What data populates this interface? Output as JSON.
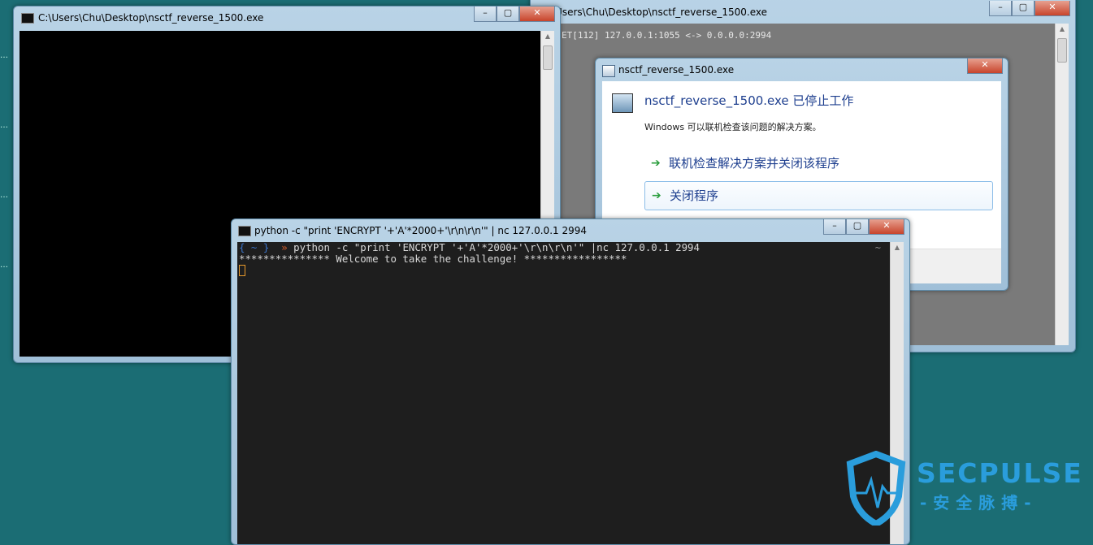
{
  "window1": {
    "title": "C:\\Users\\Chu\\Desktop\\nsctf_reverse_1500.exe",
    "controls": {
      "min": "–",
      "max": "▢",
      "close": "✕"
    }
  },
  "window2": {
    "title": "\\Users\\Chu\\Desktop\\nsctf_reverse_1500.exe",
    "console_line": "ET[112] 127.0.0.1:1055 <-> 0.0.0.0:2994",
    "controls": {
      "min": "–",
      "max": "▢",
      "close": "✕"
    }
  },
  "dialog": {
    "title": "nsctf_reverse_1500.exe",
    "heading": "nsctf_reverse_1500.exe 已停止工作",
    "subtext": "Windows 可以联机检查该问题的解决方案。",
    "options": [
      {
        "label": "联机检查解决方案并关闭该程序"
      },
      {
        "label": "关闭程序"
      }
    ],
    "close": "✕"
  },
  "terminal": {
    "title": "python -c \"print 'ENCRYPT '+'A'*2000+'\\r\\n\\r\\n'\" | nc 127.0.0.1 2994",
    "prompt_open": "{ ~ }",
    "prompt_arrow": "»",
    "command": "python -c \"print 'ENCRYPT '+'A'*2000+'\\r\\n\\r\\n'\" |nc 127.0.0.1 2994",
    "output": "*************** Welcome to take the challenge! *****************",
    "right_marker": "~",
    "controls": {
      "min": "–",
      "max": "▢",
      "close": "✕"
    }
  },
  "watermark": {
    "logo_text": "SECPULSE",
    "cn_text": "-安全脉搏-"
  },
  "colors": {
    "desktop": "#1b6d74",
    "link_blue": "#1e3f8f",
    "arrow_green": "#2a9d3c",
    "watermark": "#2a9ddc"
  }
}
